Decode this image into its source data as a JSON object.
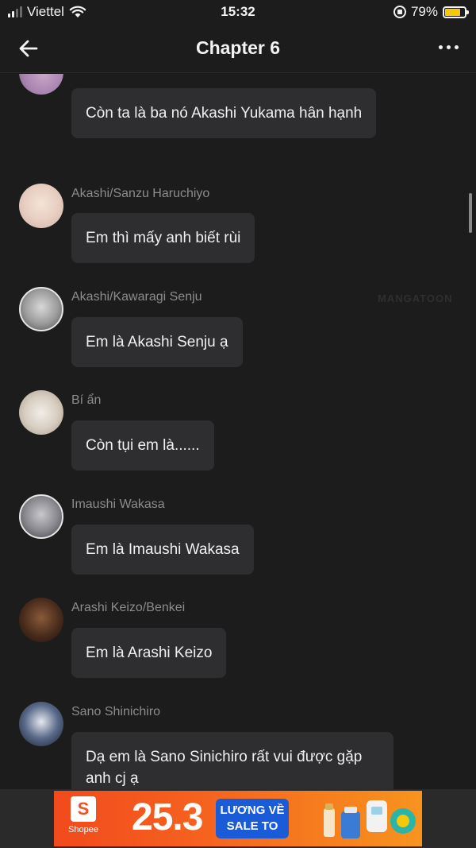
{
  "status_bar": {
    "carrier": "Viettel",
    "time": "15:32",
    "battery": "79%",
    "battery_level": 0.79,
    "battery_color": "#f5c80a"
  },
  "nav": {
    "title": "Chapter 6",
    "back_icon": "arrow-left-icon",
    "more_icon": "more-horizontal-icon"
  },
  "messages": [
    {
      "sender": "",
      "text": "Còn ta là ba nó Akashi Yukama hân hạnh"
    },
    {
      "sender": "Akashi/Sanzu Haruchiyo",
      "text": "Em thì mấy anh biết rùi"
    },
    {
      "sender": "Akashi/Kawaragi Senju",
      "text": "Em là Akashi Senju ạ"
    },
    {
      "sender": "Bí ẩn",
      "text": "Còn tụi em là......"
    },
    {
      "sender": "Imaushi Wakasa",
      "text": "Em là Imaushi Wakasa"
    },
    {
      "sender": "Arashi Keizo/Benkei",
      "text": "Em là Arashi Keizo"
    },
    {
      "sender": "Sano Shinichiro",
      "text": "Dạ em là Sano Sinichiro rất vui được gặp anh cj ạ"
    }
  ],
  "watermark": "MANGATOON",
  "ad": {
    "brand": "Shopee",
    "logo_letter": "S",
    "number": "25.3",
    "badge_line1": "LƯƠNG VỀ",
    "badge_line2": "SALE TO",
    "brand_color": "#f2521f"
  }
}
